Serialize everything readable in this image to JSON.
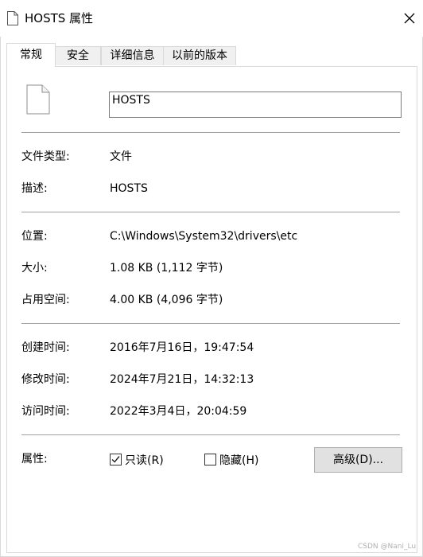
{
  "window": {
    "title": "HOSTS 属性",
    "close_glyph": "✕"
  },
  "tabs": [
    {
      "label": "常规",
      "active": true
    },
    {
      "label": "安全",
      "active": false
    },
    {
      "label": "详细信息",
      "active": false
    },
    {
      "label": "以前的版本",
      "active": false
    }
  ],
  "general": {
    "file_name": "HOSTS",
    "type_label": "文件类型:",
    "type_value": "文件",
    "desc_label": "描述:",
    "desc_value": "HOSTS",
    "location_label": "位置:",
    "location_value": "C:\\Windows\\System32\\drivers\\etc",
    "size_label": "大小:",
    "size_value": "1.08 KB (1,112 字节)",
    "size_on_disk_label": "占用空间:",
    "size_on_disk_value": "4.00 KB (4,096 字节)",
    "created_label": "创建时间:",
    "created_value": "2016年7月16日，19:47:54",
    "modified_label": "修改时间:",
    "modified_value": "2024年7月21日，14:32:13",
    "accessed_label": "访问时间:",
    "accessed_value": "2022年3月4日，20:04:59",
    "attributes_label": "属性:",
    "readonly_label": "只读(R)",
    "readonly_checked": true,
    "hidden_label": "隐藏(H)",
    "hidden_checked": false,
    "advanced_button": "高级(D)..."
  },
  "watermark": "CSDN @Nani_Lu"
}
